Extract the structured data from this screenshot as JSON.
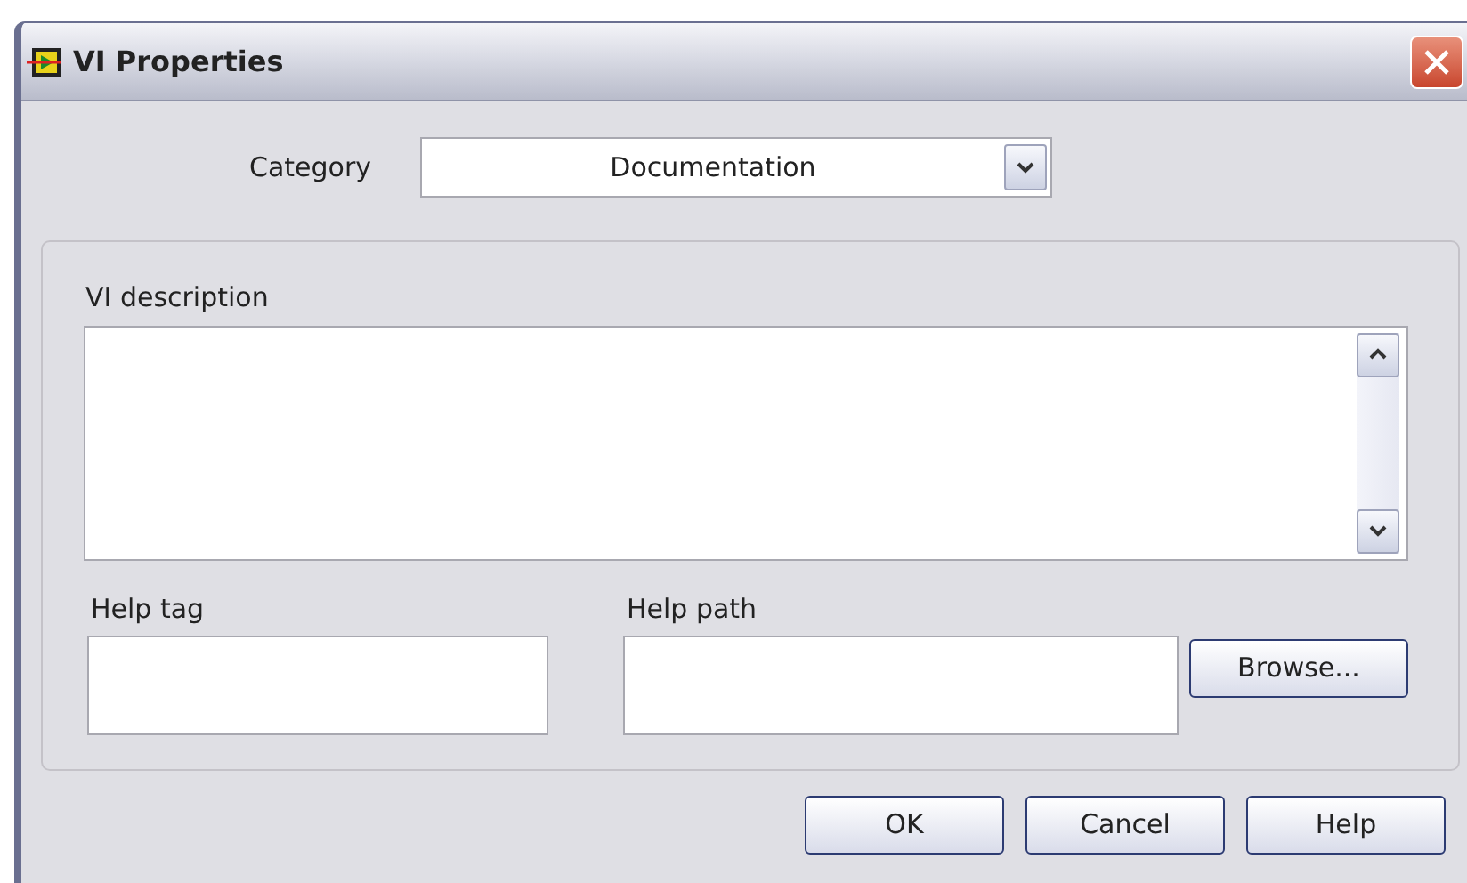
{
  "window": {
    "title": "VI Properties"
  },
  "category": {
    "label": "Category",
    "value": "Documentation"
  },
  "description": {
    "label": "VI description"
  },
  "help_tag": {
    "label": "Help tag"
  },
  "help_path": {
    "label": "Help path",
    "browse": "Browse..."
  },
  "buttons": [
    "OK",
    "Cancel",
    "Help"
  ]
}
